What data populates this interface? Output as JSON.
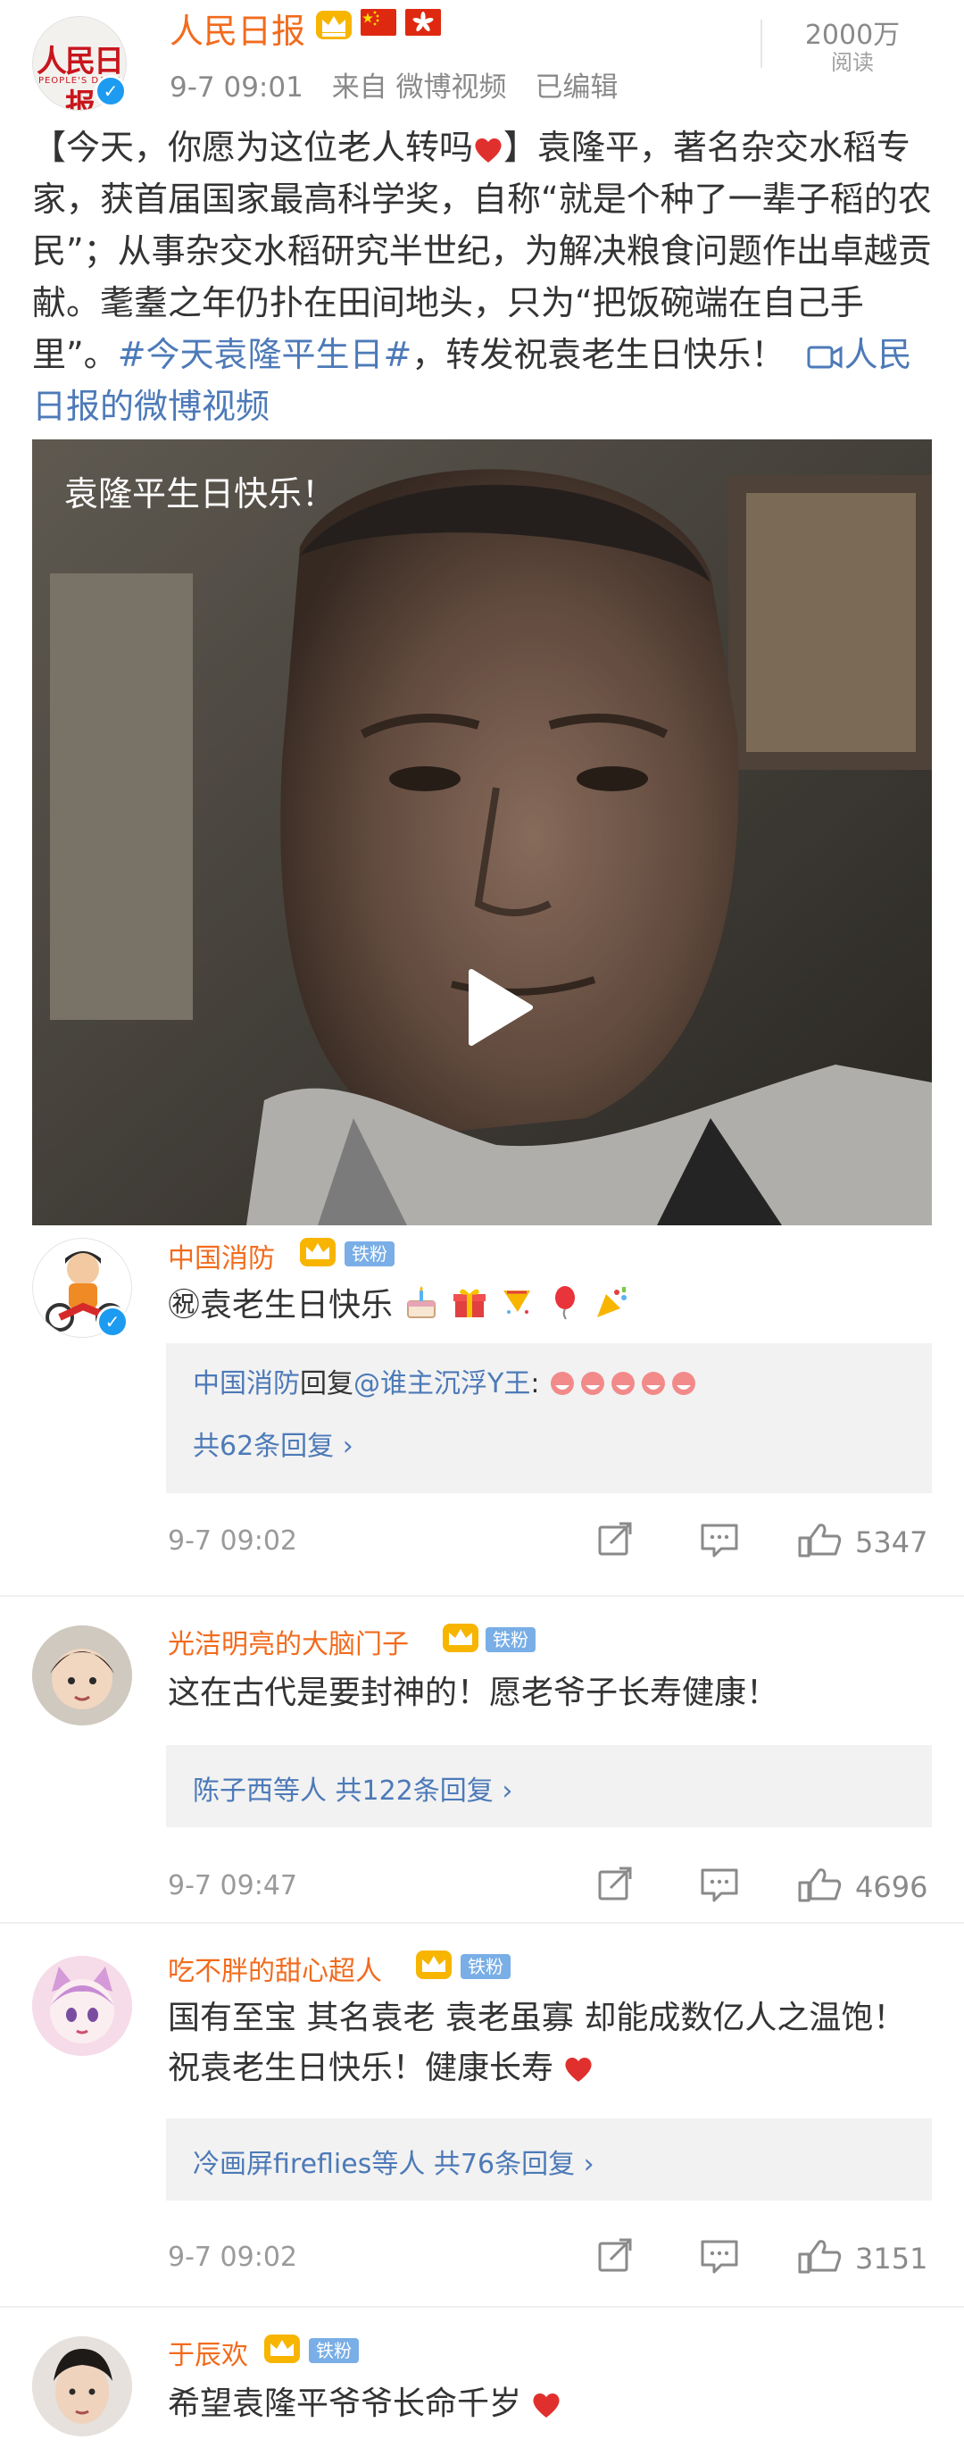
{
  "post": {
    "author": "人民日报",
    "avatar_logo": "人民日报",
    "avatar_sub": "PEOPLE'S DAILY",
    "time": "9-7 09:01",
    "source": "来自 微博视频",
    "edited": "已编辑",
    "views_count": "2000万",
    "views_label": "阅读",
    "body_part1": "【今天，你愿为这位老人转吗",
    "body_part2": "】袁隆平，著名杂交水稻专家，获首届国家最高科学奖，自称“就是个种了一辈子稻的农民”；从事杂交水稻研究半世纪，为解决粮食问题作出卓越贡献。耄耋之年仍扑在田间地头，只为“把饭碗端在自己手里”。",
    "hashtag": "#今天袁隆平生日#",
    "body_part3": "，转发祝袁老生日快乐！",
    "video_link": "人民日报的微博视频",
    "video_caption": "袁隆平生日快乐！"
  },
  "comments": [
    {
      "name": "中国消防",
      "badge": "铁粉",
      "text": "㊗袁老生日快乐",
      "reply_user": "中国消防",
      "reply_verb": "回复",
      "reply_target": "@谁主沉浮Y王",
      "reply_colon": ":",
      "reply_summary": "共62条回复 ›",
      "date": "9-7 09:02",
      "likes": "5347"
    },
    {
      "name": "光洁明亮的大脑门子",
      "badge": "铁粉",
      "text": "这在古代是要封神的！愿老爷子长寿健康！",
      "reply_people": "陈子西等人",
      "reply_summary": "共122条回复 ›",
      "date": "9-7 09:47",
      "likes": "4696"
    },
    {
      "name": "吃不胖的甜心超人",
      "badge": "铁粉",
      "text": "国有至宝  其名袁老  袁老虽寡  却能成数亿人之温饱！祝袁老生日快乐！健康长寿",
      "reply_people": "冷画屏fireflies等人",
      "reply_summary": "共76条回复 ›",
      "date": "9-7 09:02",
      "likes": "3151"
    },
    {
      "name": "于辰欢",
      "badge": "铁粉",
      "text": "希望袁隆平爷爷长命千岁"
    }
  ],
  "colors": {
    "brand_orange": "#f26b1d",
    "link_blue": "#4d7ab8",
    "heart_red": "#e0302e",
    "fan_badge": "#79aee6"
  },
  "icons": [
    "verified-icon",
    "crown-icon",
    "china-flag-icon",
    "hongkong-flag-icon",
    "play-icon",
    "share-icon",
    "comment-icon",
    "like-icon",
    "heart-icon",
    "cake-icon",
    "gift-icon",
    "balloon-icon",
    "party-popper-icon"
  ]
}
